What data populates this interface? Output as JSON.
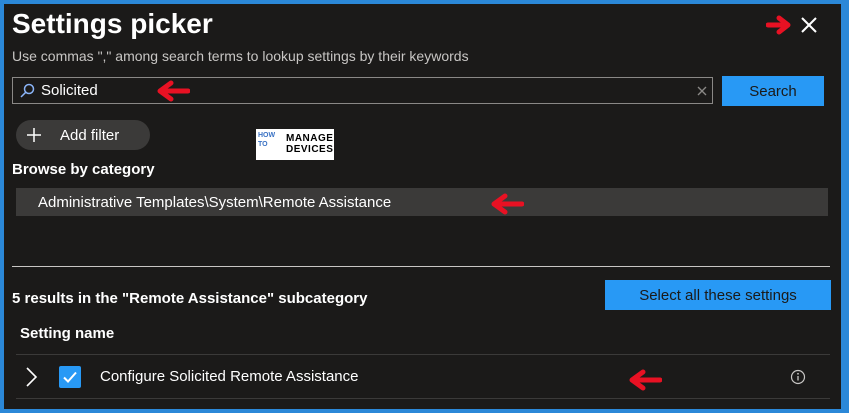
{
  "panel": {
    "title": "Settings picker",
    "subtitle": "Use commas \",\" among search terms to lookup settings by their keywords"
  },
  "search": {
    "value": "Solicited",
    "button_label": "Search"
  },
  "filter": {
    "add_label": "Add filter"
  },
  "logo": {
    "line1": "HOW",
    "line2": "TO",
    "line3": "MANAGE",
    "line4": "DEVICES"
  },
  "browse": {
    "heading": "Browse by category",
    "selected_category": "Administrative Templates\\System\\Remote Assistance"
  },
  "results": {
    "count_text": "5 results in the \"Remote Assistance\" subcategory",
    "select_all_label": "Select all these settings",
    "column_header": "Setting name",
    "rows": [
      {
        "name": "Configure Solicited Remote Assistance",
        "checked": true
      }
    ]
  },
  "colors": {
    "accent": "#2899f5",
    "background": "#1b1a19",
    "frame": "#2b88d8",
    "annotation_arrow": "#e81123"
  },
  "icons": [
    "close-icon",
    "search-icon",
    "clear-icon",
    "plus-icon",
    "chevron-right-icon",
    "checkmark-icon",
    "info-icon",
    "arrow-left-icon"
  ]
}
